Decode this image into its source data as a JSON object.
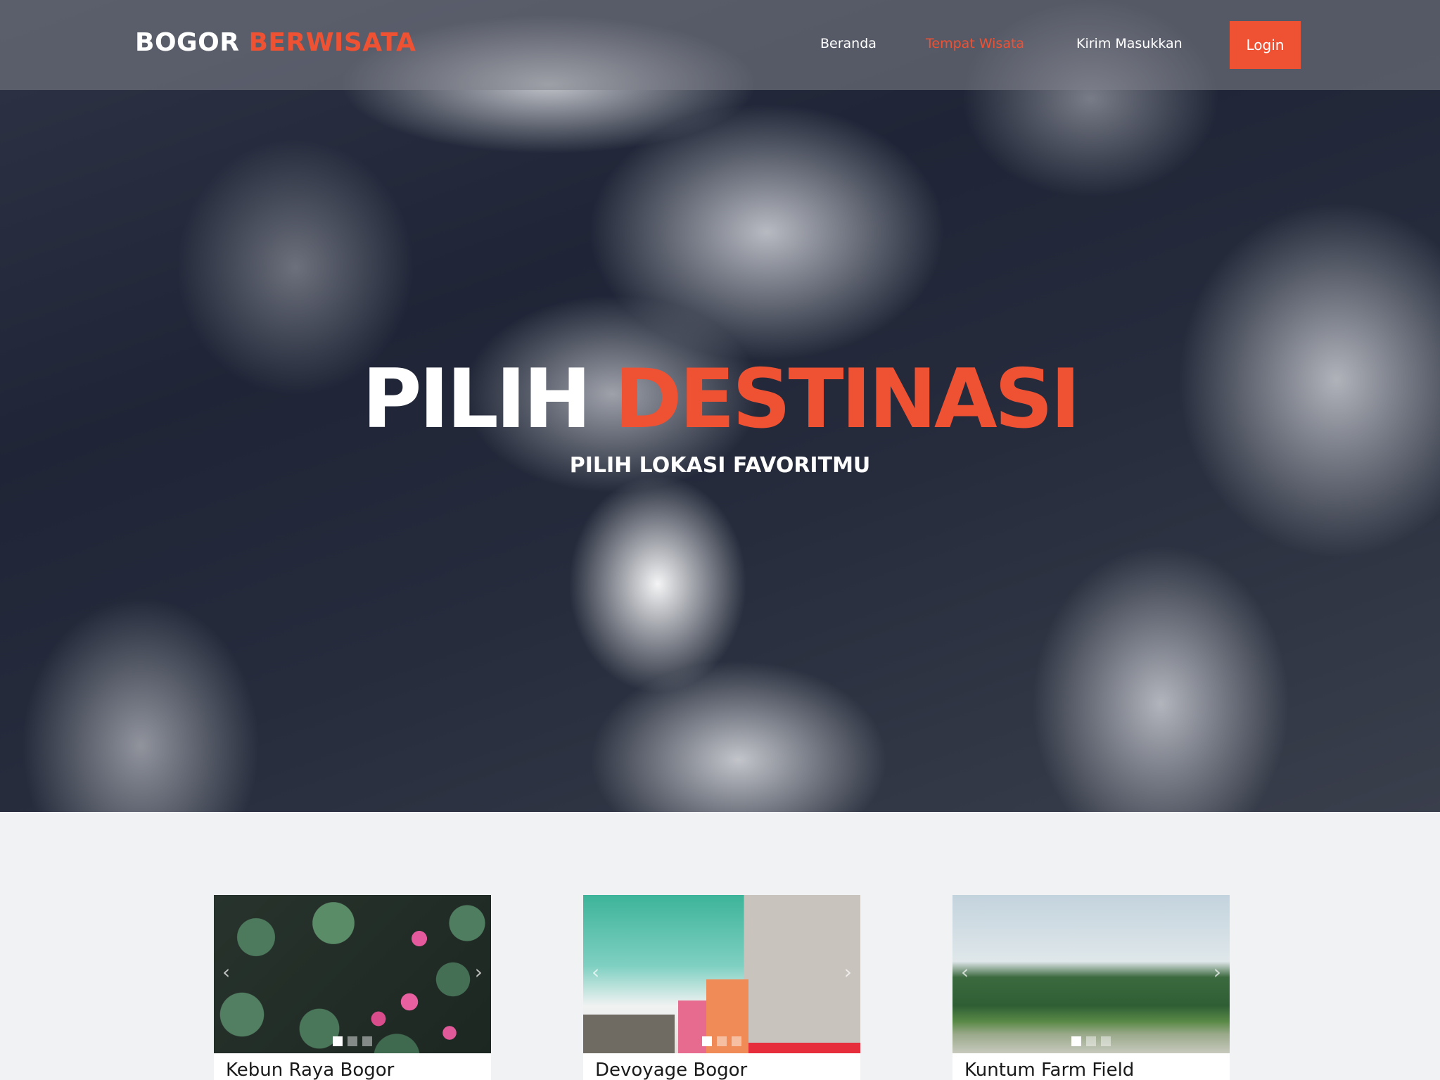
{
  "brand": {
    "part1": "BOGOR",
    "part2": "BERWISATA"
  },
  "nav": {
    "items": [
      {
        "label": "Beranda",
        "active": false
      },
      {
        "label": "Tempat Wisata",
        "active": true
      },
      {
        "label": "Kirim Masukkan",
        "active": false
      }
    ],
    "login_label": "Login"
  },
  "hero": {
    "title_white": "PILIH",
    "title_accent": "DESTINASI",
    "subtitle": "PILIH LOKASI FAVORITMU"
  },
  "cards": [
    {
      "title": "Kebun Raya Bogor",
      "slides": 3,
      "active_slide": 1
    },
    {
      "title": "Devoyage Bogor",
      "slides": 3,
      "active_slide": 1
    },
    {
      "title": "Kuntum Farm Field",
      "slides": 3,
      "active_slide": 1
    }
  ],
  "carousel": {
    "prev_icon": "chevron-left-icon",
    "next_icon": "chevron-right-icon"
  },
  "colors": {
    "accent": "#ef5133",
    "background": "#f1f2f4",
    "card": "#ffffff"
  }
}
